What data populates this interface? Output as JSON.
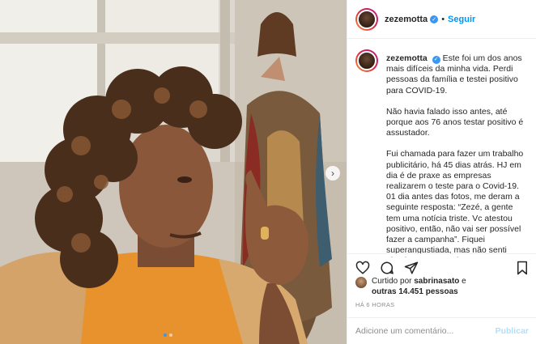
{
  "post": {
    "username": "zezemotta",
    "follow_label": "Seguir",
    "separator": "•",
    "verified_icon": "✓"
  },
  "caption": {
    "username": "zezemotta",
    "paragraphs": [
      "Este foi um dos anos mais difíceis da minha vida. Perdi pessoas da família e testei positivo para COVID-19.",
      "Não havia falado isso antes, até porque aos 76 anos testar positivo é assustador.",
      "Fui chamada para fazer um trabalho publicitário, há 45 dias atrás. HJ em dia é de praxe as empresas realizarem o teste para o Covid-19. 01 dia antes das fotos, me deram a seguinte resposta: “Zezé, a gente tem uma notícia triste. Vc atestou positivo, então, não vai ser possível fazer a campanha”. Fiquei superangustiada, mas não senti absolutamente nada."
    ]
  },
  "likes": {
    "prefix": "Curtido por",
    "user": "sabrinasato",
    "joiner": "e",
    "others": "outras 14.451 pessoas"
  },
  "timestamp": "HÁ 6 HORAS",
  "comment": {
    "placeholder": "Adicione um comentário...",
    "publish_label": "Publicar"
  },
  "carousel": {
    "next_glyph": "›",
    "total_slides": 2,
    "active_slide": 1
  },
  "colors": {
    "accent": "#0095f6",
    "verified": "#3897f0",
    "muted": "#8e8e8e",
    "publish_disabled": "#b2dffc"
  }
}
